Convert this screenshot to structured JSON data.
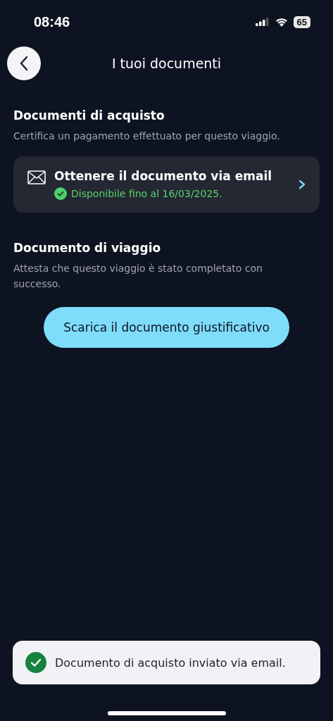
{
  "status_bar": {
    "time": "08:46",
    "battery": "65"
  },
  "header": {
    "title": "I tuoi documenti"
  },
  "sections": [
    {
      "kind": "card",
      "title": "Documenti di acquisto",
      "description": "Certifica un pagamento effettuato per questo viaggio.",
      "card": {
        "title": "Ottenere il documento via email",
        "status": "Disponibile fino al 16/03/2025."
      }
    },
    {
      "kind": "button",
      "title": "Documento di viaggio",
      "description": "Attesta che questo viaggio è stato completato con successo.",
      "button": "Scarica il documento giustificativo"
    }
  ],
  "toast": {
    "message": "Documento di acquisto inviato via email."
  }
}
